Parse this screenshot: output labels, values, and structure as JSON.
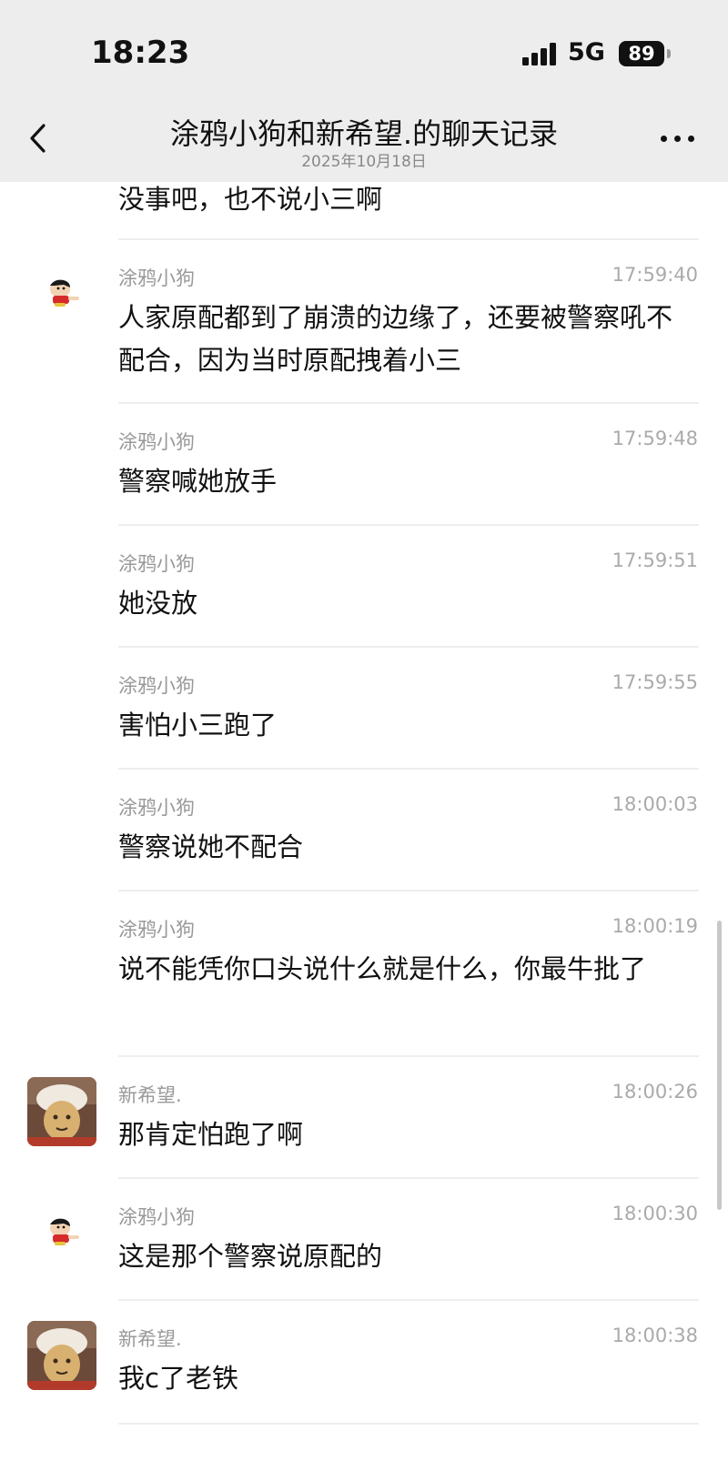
{
  "status_bar": {
    "time": "18:23",
    "network": "5G",
    "battery": "89"
  },
  "header": {
    "title": "涂鸦小狗和新希望.的聊天记录",
    "date": "2025年10月18日"
  },
  "messages": [
    {
      "sender": "",
      "time": "",
      "text": "没事吧，也不说小三啊"
    },
    {
      "sender": "涂鸦小狗",
      "time": "17:59:40",
      "text": "人家原配都到了崩溃的边缘了，还要被警察吼不配合，因为当时原配拽着小三"
    },
    {
      "sender": "涂鸦小狗",
      "time": "17:59:48",
      "text": "警察喊她放手"
    },
    {
      "sender": "涂鸦小狗",
      "time": "17:59:51",
      "text": "她没放"
    },
    {
      "sender": "涂鸦小狗",
      "time": "17:59:55",
      "text": "害怕小三跑了"
    },
    {
      "sender": "涂鸦小狗",
      "time": "18:00:03",
      "text": "警察说她不配合"
    },
    {
      "sender": "涂鸦小狗",
      "time": "18:00:19",
      "text": "说不能凭你口头说什么就是什么，你最牛批了"
    },
    {
      "sender": "新希望.",
      "time": "18:00:26",
      "text": "那肯定怕跑了啊"
    },
    {
      "sender": "涂鸦小狗",
      "time": "18:00:30",
      "text": "这是那个警察说原配的"
    },
    {
      "sender": "新希望.",
      "time": "18:00:38",
      "text": "我c了老铁"
    }
  ],
  "colors": {
    "header_bg": "#ededed",
    "text": "#111111",
    "meta_text": "#999999",
    "separator": "#eeeeee"
  },
  "icons": {
    "back": "chevron-left-icon",
    "more": "ellipsis-icon",
    "signal": "cellular-signal-icon",
    "battery": "battery-icon"
  }
}
